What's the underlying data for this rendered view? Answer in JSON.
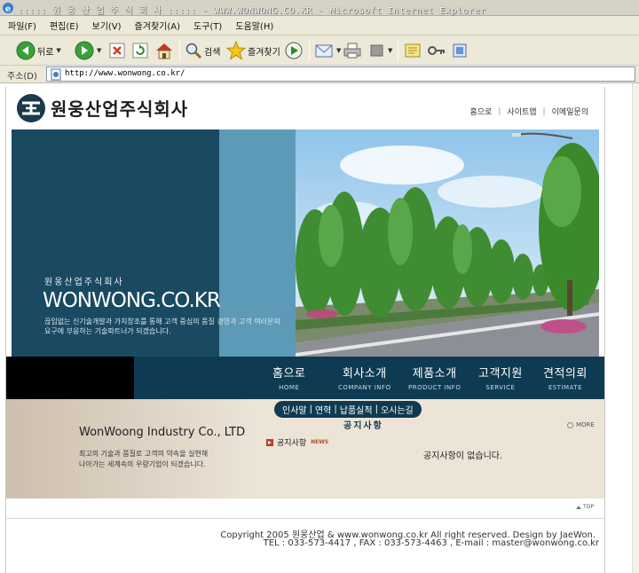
{
  "browser": {
    "title": "::::: 원 웅 산 업 주 식 회 사 ::::: - WWW.WONWONG.CO.KR - Microsoft Internet Explorer",
    "menu": [
      "파일(F)",
      "편집(E)",
      "보기(V)",
      "즐겨찾기(A)",
      "도구(T)",
      "도움말(H)"
    ],
    "toolbar": {
      "back_label": "뒤로",
      "search_label": "검색",
      "favorites_label": "즐겨찾기"
    },
    "address_label": "주소(D)",
    "address_url": "http://www.wonwong.co.kr/"
  },
  "site": {
    "logo_text": "원웅산업주식회사",
    "top_links": [
      "홈으로",
      "사이트맵",
      "이메일문의"
    ],
    "hero": {
      "company_kr": "원웅산업주식회사",
      "domain": "WONWONG.CO.KR",
      "desc_line1": "끊임없는 신기술개발과 가치창조를 통해 고객 중심의 품질 경영과 고객 여러분의",
      "desc_line2": "요구에 부응하는 기술파트너가 되겠습니다."
    },
    "nav": [
      {
        "kr": "홈으로",
        "en": "HOME"
      },
      {
        "kr": "회사소개",
        "en": "COMPANY INFO"
      },
      {
        "kr": "제품소개",
        "en": "PRODUCT INFO"
      },
      {
        "kr": "고객지원",
        "en": "SERVICE"
      },
      {
        "kr": "견적의뢰",
        "en": "ESTIMATE"
      }
    ],
    "subnav": [
      "인사말",
      "연혁",
      "납품실적",
      "오시는길"
    ],
    "company_en": "WonWoong Industry Co., LTD",
    "company_desc_line1": "최고의 기술과 품질로 고객의 약속을 실현해",
    "company_desc_line2": "나아가는 세계속의 우량기업이 되겠습니다.",
    "notice": {
      "heading": "공지사항",
      "label": "공지사항",
      "news_tag": "NEWS",
      "more": "MORE",
      "empty_text": "공지사항이 없습니다."
    },
    "top_link": "TOP",
    "copyright": "Copyright 2005 원웅산업 & www.wonwong.co.kr All right reserved. Design by JaeWon.",
    "contact": "TEL : 033-573-4417 , FAX : 033-573-4463 , E-mail : master@wonwong.co.kr"
  },
  "colors": {
    "navy": "#0f3b52",
    "hero_blue": "#1a4a62",
    "hero_stripe": "#5d9ab7",
    "beige": "#ece4d7"
  }
}
